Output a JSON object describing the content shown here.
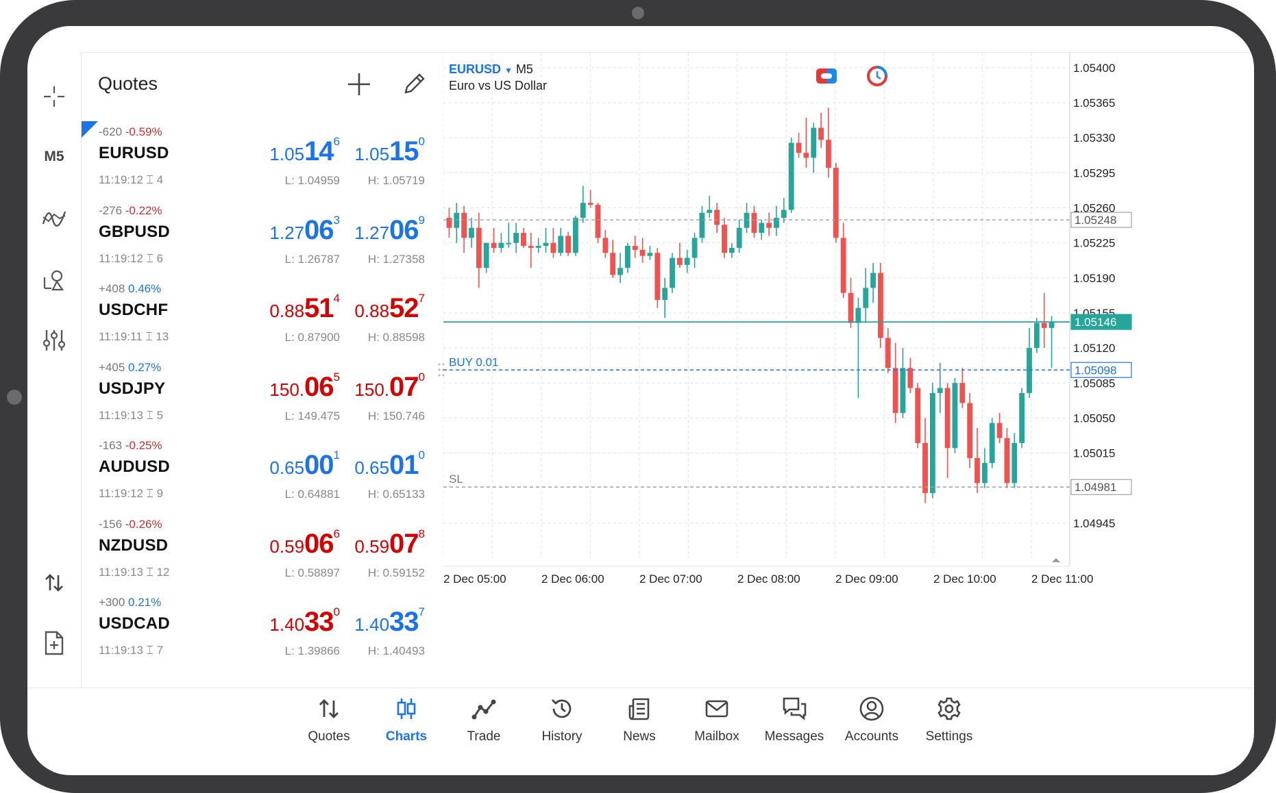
{
  "left_toolbar": {
    "timeframe_label": "M5",
    "icons": [
      "crosshair-icon",
      "indicators-icon",
      "objects-icon",
      "settings-sliders-icon",
      "one-click-trade-icon",
      "new-order-icon"
    ]
  },
  "quotes": {
    "title": "Quotes",
    "rows": [
      {
        "change_points": "-620",
        "change_pct": "-0.59%",
        "direction": "neg",
        "symbol": "EURUSD",
        "time": "11:19:12",
        "spread": "4",
        "bid": {
          "a": "1.05",
          "b": "14",
          "c": "6",
          "color": "blue"
        },
        "ask": {
          "a": "1.05",
          "b": "15",
          "c": "0",
          "color": "blue"
        },
        "low": "L: 1.04959",
        "high": "H: 1.05719"
      },
      {
        "change_points": "-276",
        "change_pct": "-0.22%",
        "direction": "neg",
        "symbol": "GBPUSD",
        "time": "11:19:12",
        "spread": "6",
        "bid": {
          "a": "1.27",
          "b": "06",
          "c": "3",
          "color": "blue"
        },
        "ask": {
          "a": "1.27",
          "b": "06",
          "c": "9",
          "color": "blue"
        },
        "low": "L: 1.26787",
        "high": "H: 1.27358"
      },
      {
        "change_points": "+408",
        "change_pct": "0.46%",
        "direction": "pos",
        "symbol": "USDCHF",
        "time": "11:19:11",
        "spread": "13",
        "bid": {
          "a": "0.88",
          "b": "51",
          "c": "4",
          "color": "red"
        },
        "ask": {
          "a": "0.88",
          "b": "52",
          "c": "7",
          "color": "red"
        },
        "low": "L: 0.87900",
        "high": "H: 0.88598"
      },
      {
        "change_points": "+405",
        "change_pct": "0.27%",
        "direction": "pos",
        "symbol": "USDJPY",
        "time": "11:19:13",
        "spread": "5",
        "bid": {
          "a": "150.",
          "b": "06",
          "c": "5",
          "color": "red"
        },
        "ask": {
          "a": "150.",
          "b": "07",
          "c": "0",
          "color": "red"
        },
        "low": "L: 149.475",
        "high": "H: 150.746"
      },
      {
        "change_points": "-163",
        "change_pct": "-0.25%",
        "direction": "neg",
        "symbol": "AUDUSD",
        "time": "11:19:12",
        "spread": "9",
        "bid": {
          "a": "0.65",
          "b": "00",
          "c": "1",
          "color": "blue"
        },
        "ask": {
          "a": "0.65",
          "b": "01",
          "c": "0",
          "color": "blue"
        },
        "low": "L: 0.64881",
        "high": "H: 0.65133"
      },
      {
        "change_points": "-156",
        "change_pct": "-0.26%",
        "direction": "neg",
        "symbol": "NZDUSD",
        "time": "11:19:13",
        "spread": "12",
        "bid": {
          "a": "0.59",
          "b": "06",
          "c": "6",
          "color": "red"
        },
        "ask": {
          "a": "0.59",
          "b": "07",
          "c": "8",
          "color": "red"
        },
        "low": "L: 0.58897",
        "high": "H: 0.59152"
      },
      {
        "change_points": "+300",
        "change_pct": "0.21%",
        "direction": "pos",
        "symbol": "USDCAD",
        "time": "11:19:13",
        "spread": "7",
        "bid": {
          "a": "1.40",
          "b": "33",
          "c": "0",
          "color": "red"
        },
        "ask": {
          "a": "1.40",
          "b": "33",
          "c": "7",
          "color": "blue"
        },
        "low": "L: 1.39866",
        "high": "H: 1.40493"
      }
    ]
  },
  "chart": {
    "symbol": "EURUSD",
    "timeframe": "M5",
    "description": "Euro vs US Dollar",
    "colors": {
      "bull": "#26a69a",
      "bear": "#ef5350",
      "grid": "#e3e3e3",
      "buy": "#1a73e8",
      "bid_line": "#26a69a",
      "sl": "#9e9e9e"
    }
  },
  "chart_data": {
    "type": "candlestick",
    "symbol": "EURUSD",
    "timeframe": "M5",
    "y_ticks": [
      "1.05400",
      "1.05365",
      "1.05330",
      "1.05295",
      "1.05260",
      "1.05225",
      "1.05190",
      "1.05155",
      "1.05120",
      "1.05085",
      "1.05050",
      "1.05015",
      "1.04945"
    ],
    "ylim": [
      1.0491,
      1.05415
    ],
    "x_ticks": [
      "2 Dec 05:00",
      "2 Dec 06:00",
      "2 Dec 07:00",
      "2 Dec 08:00",
      "2 Dec 09:00",
      "2 Dec 10:00",
      "2 Dec 11:00"
    ],
    "lines": [
      {
        "label": "",
        "price": 1.05248,
        "price_label": "1.05248",
        "style": "dashed",
        "kind": "grey"
      },
      {
        "label": "",
        "price": 1.05146,
        "price_label": "1.05146",
        "style": "solid",
        "kind": "bid"
      },
      {
        "label": "BUY 0.01",
        "price": 1.05098,
        "price_label": "1.05098",
        "style": "dashed",
        "kind": "buy"
      },
      {
        "label": "SL",
        "price": 1.04981,
        "price_label": "1.04981",
        "style": "dashed",
        "kind": "sl"
      }
    ],
    "candles": [
      [
        1.0525,
        1.0526,
        1.0523,
        1.0524
      ],
      [
        1.0524,
        1.05265,
        1.05225,
        1.05255
      ],
      [
        1.05255,
        1.05262,
        1.05215,
        1.0523
      ],
      [
        1.0523,
        1.0525,
        1.0522,
        1.0524
      ],
      [
        1.0524,
        1.05255,
        1.0518,
        1.052
      ],
      [
        1.052,
        1.05225,
        1.05195,
        1.05225
      ],
      [
        1.05225,
        1.0524,
        1.05215,
        1.0522
      ],
      [
        1.0522,
        1.05235,
        1.05215,
        1.05225
      ],
      [
        1.05225,
        1.05245,
        1.0522,
        1.05225
      ],
      [
        1.05225,
        1.05245,
        1.05215,
        1.05235
      ],
      [
        1.05235,
        1.0524,
        1.0522,
        1.05222
      ],
      [
        1.05222,
        1.05235,
        1.052,
        1.0522
      ],
      [
        1.0522,
        1.0523,
        1.05215,
        1.05222
      ],
      [
        1.05222,
        1.0524,
        1.05215,
        1.05225
      ],
      [
        1.05225,
        1.0524,
        1.0521,
        1.05215
      ],
      [
        1.05215,
        1.0524,
        1.05212,
        1.05232
      ],
      [
        1.05232,
        1.05236,
        1.05212,
        1.05215
      ],
      [
        1.05215,
        1.05252,
        1.05212,
        1.0525
      ],
      [
        1.0525,
        1.05282,
        1.05245,
        1.05265
      ],
      [
        1.05265,
        1.05278,
        1.0526,
        1.05263
      ],
      [
        1.05263,
        1.05265,
        1.05225,
        1.0523
      ],
      [
        1.0523,
        1.05238,
        1.0521,
        1.05215
      ],
      [
        1.05215,
        1.05228,
        1.0519,
        1.05193
      ],
      [
        1.05193,
        1.05215,
        1.05185,
        1.052
      ],
      [
        1.052,
        1.05225,
        1.05195,
        1.05222
      ],
      [
        1.05222,
        1.05232,
        1.0521,
        1.05218
      ],
      [
        1.05218,
        1.0523,
        1.05205,
        1.05212
      ],
      [
        1.05212,
        1.05222,
        1.05208,
        1.05215
      ],
      [
        1.05215,
        1.0522,
        1.0516,
        1.05168
      ],
      [
        1.05168,
        1.0519,
        1.0515,
        1.0518
      ],
      [
        1.0518,
        1.05215,
        1.05175,
        1.0521
      ],
      [
        1.0521,
        1.05225,
        1.052,
        1.05203
      ],
      [
        1.05203,
        1.05218,
        1.05195,
        1.0521
      ],
      [
        1.0521,
        1.05235,
        1.052,
        1.0523
      ],
      [
        1.0523,
        1.05262,
        1.05225,
        1.05255
      ],
      [
        1.05255,
        1.05272,
        1.0525,
        1.05258
      ],
      [
        1.05258,
        1.05265,
        1.05235,
        1.05243
      ],
      [
        1.05243,
        1.0525,
        1.0521,
        1.05215
      ],
      [
        1.05215,
        1.05225,
        1.0521,
        1.0522
      ],
      [
        1.0522,
        1.05248,
        1.05215,
        1.0524
      ],
      [
        1.0524,
        1.05265,
        1.05235,
        1.05255
      ],
      [
        1.05255,
        1.05262,
        1.0523,
        1.05235
      ],
      [
        1.05235,
        1.05248,
        1.05228,
        1.05245
      ],
      [
        1.05245,
        1.05255,
        1.05232,
        1.0524
      ],
      [
        1.0524,
        1.05262,
        1.05232,
        1.0525
      ],
      [
        1.0525,
        1.0527,
        1.05245,
        1.05258
      ],
      [
        1.05258,
        1.0533,
        1.05255,
        1.05325
      ],
      [
        1.05325,
        1.05335,
        1.0531,
        1.05315
      ],
      [
        1.05315,
        1.0535,
        1.053,
        1.0531
      ],
      [
        1.0531,
        1.05345,
        1.05295,
        1.0534
      ],
      [
        1.0534,
        1.05355,
        1.0532,
        1.05328
      ],
      [
        1.05328,
        1.0536,
        1.0529,
        1.053
      ],
      [
        1.053,
        1.05305,
        1.05225,
        1.0523
      ],
      [
        1.0523,
        1.05245,
        1.0517,
        1.05175
      ],
      [
        1.05175,
        1.0519,
        1.0514,
        1.05145
      ],
      [
        1.05145,
        1.0517,
        1.0507,
        1.0516
      ],
      [
        1.0516,
        1.052,
        1.05145,
        1.0518
      ],
      [
        1.0518,
        1.05205,
        1.05165,
        1.05195
      ],
      [
        1.05195,
        1.05205,
        1.0512,
        1.0513
      ],
      [
        1.0513,
        1.0514,
        1.05095,
        1.051
      ],
      [
        1.051,
        1.05125,
        1.05045,
        1.05055
      ],
      [
        1.05055,
        1.0512,
        1.0505,
        1.051
      ],
      [
        1.051,
        1.0511,
        1.05075,
        1.0508
      ],
      [
        1.0508,
        1.05085,
        1.0502,
        1.05025
      ],
      [
        1.05025,
        1.0505,
        1.04965,
        1.04975
      ],
      [
        1.04975,
        1.05085,
        1.0497,
        1.05075
      ],
      [
        1.05075,
        1.05105,
        1.05055,
        1.0508
      ],
      [
        1.0508,
        1.05085,
        1.0499,
        1.0502
      ],
      [
        1.0502,
        1.0509,
        1.05015,
        1.05085
      ],
      [
        1.05085,
        1.051,
        1.0506,
        1.05065
      ],
      [
        1.05065,
        1.05075,
        1.05,
        1.0501
      ],
      [
        1.0501,
        1.0504,
        1.04975,
        1.04985
      ],
      [
        1.04985,
        1.0502,
        1.0498,
        1.05005
      ],
      [
        1.05005,
        1.0505,
        1.05,
        1.05045
      ],
      [
        1.05045,
        1.05055,
        1.05025,
        1.0503
      ],
      [
        1.0503,
        1.0504,
        1.0498,
        1.04985
      ],
      [
        1.04985,
        1.05035,
        1.0498,
        1.05025
      ],
      [
        1.05025,
        1.0508,
        1.0502,
        1.05075
      ],
      [
        1.05075,
        1.0514,
        1.0507,
        1.0512
      ],
      [
        1.0512,
        1.0515,
        1.05115,
        1.05145
      ],
      [
        1.05145,
        1.05175,
        1.0512,
        1.0514
      ],
      [
        1.0514,
        1.05152,
        1.051,
        1.05146
      ]
    ]
  },
  "bottom_nav": {
    "items": [
      {
        "label": "Quotes",
        "icon": "quotes-arrows-icon",
        "active": false
      },
      {
        "label": "Charts",
        "icon": "candles-icon",
        "active": true
      },
      {
        "label": "Trade",
        "icon": "trade-line-icon",
        "active": false
      },
      {
        "label": "History",
        "icon": "history-clock-icon",
        "active": false
      },
      {
        "label": "News",
        "icon": "news-icon",
        "active": false
      },
      {
        "label": "Mailbox",
        "icon": "mail-icon",
        "active": false
      },
      {
        "label": "Messages",
        "icon": "messages-icon",
        "active": false
      },
      {
        "label": "Accounts",
        "icon": "accounts-icon",
        "active": false
      },
      {
        "label": "Settings",
        "icon": "gear-icon",
        "active": false
      }
    ]
  }
}
